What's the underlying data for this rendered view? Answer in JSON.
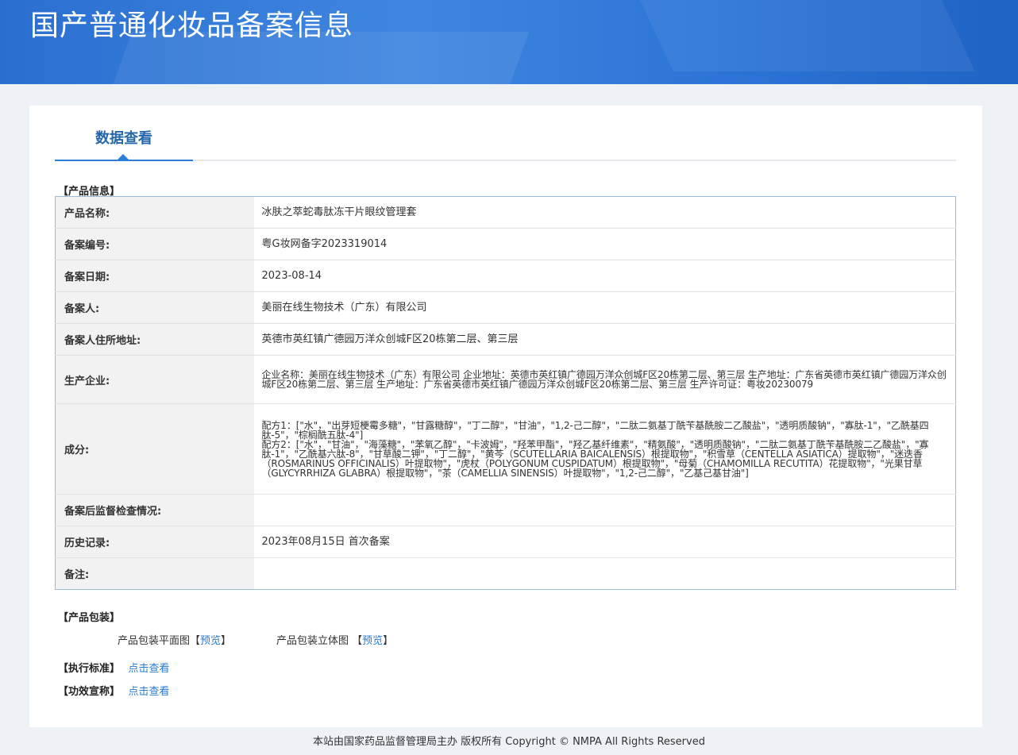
{
  "header": {
    "title": "国产普通化妆品备案信息"
  },
  "tab": {
    "label": "数据查看"
  },
  "sections": {
    "product_info": "【产品信息】",
    "packaging": "【产品包装】",
    "standard": "【执行标准】",
    "efficacy": "【功效宣称】"
  },
  "rows": [
    {
      "key": "产品名称:",
      "value": "冰肤之萃蛇毒肽冻干片眼纹管理套"
    },
    {
      "key": "备案编号:",
      "value": "粤G妆网备字2023319014"
    },
    {
      "key": "备案日期:",
      "value": "2023-08-14"
    },
    {
      "key": "备案人:",
      "value": "美丽在线生物技术（广东）有限公司"
    },
    {
      "key": "备案人住所地址:",
      "value": "英德市英红镇广德园万洋众创城F区20栋第二层、第三层"
    },
    {
      "key": "生产企业:",
      "value": "企业名称：美丽在线生物技术（广东）有限公司 企业地址：英德市英红镇广德园万洋众创城F区20栋第二层、第三层 生产地址：广东省英德市英红镇广德园万洋众创城F区20栋第二层、第三层 生产地址：广东省英德市英红镇广德园万洋众创城F区20栋第二层、第三层 生产许可证：粤妆20230079"
    },
    {
      "key": "成分:",
      "value": "",
      "lines": [
        "配方1：[\"水\"，\"出芽短梗霉多糖\"，\"甘露糖醇\"，\"丁二醇\"，\"甘油\"，\"1,2-己二醇\"，\"二肽二氨基丁酰苄基酰胺二乙酸盐\"，\"透明质酸钠\"，\"寡肽-1\"，\"乙酰基四肽-5\"，\"棕榈酰五肽-4\"]",
        "配方2：[\"水\"，\"甘油\"，\"海藻糖\"，\"苯氧乙醇\"，\"卡波姆\"，\"羟苯甲酯\"，\"羟乙基纤维素\"，\"精氨酸\"，\"透明质酸钠\"，\"二肽二氨基丁酰苄基酰胺二乙酸盐\"，\"寡肽-1\"，\"乙酰基六肽-8\"，\"甘草酸二钾\"，\"丁二醇\"，\"黄芩（SCUTELLARIA BAICALENSIS）根提取物\"，\"积雪草（CENTELLA ASIATICA）提取物\"，\"迷迭香（ROSMARINUS OFFICINALIS）叶提取物\"，\"虎杖（POLYGONUM CUSPIDATUM）根提取物\"，\"母菊（CHAMOMILLA RECUTITA）花提取物\"，\"光果甘草（GLYCYRRHIZA GLABRA）根提取物\"，\"茶（CAMELLIA SINENSIS）叶提取物\"，\"1,2-己二醇\"，\"乙基己基甘油\"]"
      ]
    },
    {
      "key": "备案后监督检查情况:",
      "value": ""
    },
    {
      "key": "历史记录:",
      "value": "2023年08月15日 首次备案"
    },
    {
      "key": "备注:",
      "value": ""
    }
  ],
  "packaging": {
    "flat_label": "产品包装平面图",
    "flat_preview": "预览",
    "solid_label": "产品包装立体图",
    "solid_preview": "预览"
  },
  "links": {
    "standard": "点击查看",
    "efficacy": "点击查看"
  },
  "footer": {
    "text": "本站由国家药品监督管理局主办 版权所有 Copyright © NMPA All Rights Reserved"
  }
}
